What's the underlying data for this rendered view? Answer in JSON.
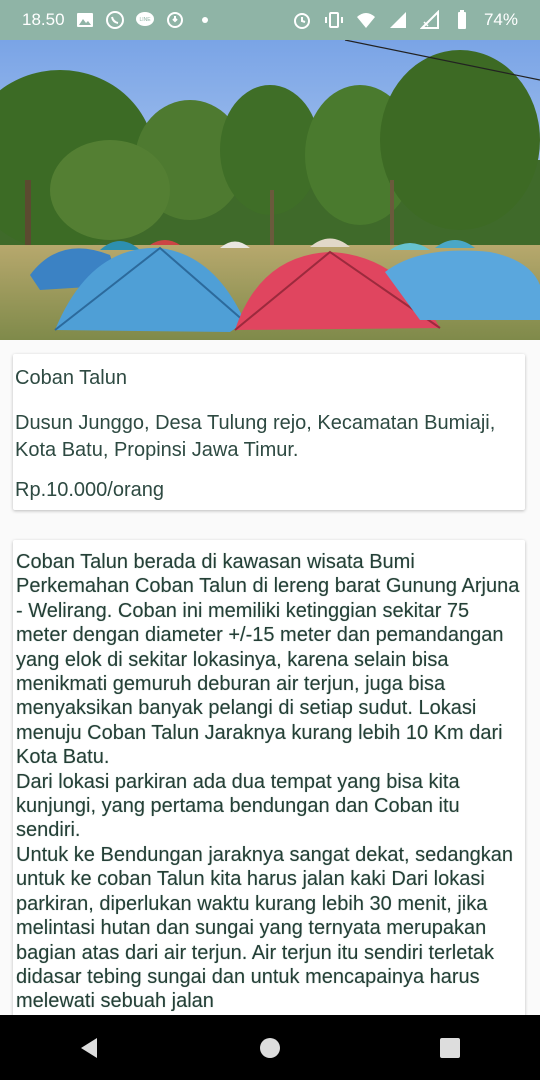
{
  "status_bar": {
    "time": "18.50",
    "battery": "74%",
    "icons_left": [
      "image-icon",
      "whatsapp-icon",
      "line-icon",
      "sync-icon",
      "dot-icon"
    ],
    "icons_right": [
      "alarm-icon",
      "vibrate-icon",
      "wifi-icon",
      "signal-icon",
      "signal-x-icon",
      "battery-icon"
    ]
  },
  "place": {
    "name": "Coban Talun",
    "address": "Dusun Junggo, Desa Tulung rejo, Kecamatan Bumiaji, Kota Batu, Propinsi Jawa Timur.",
    "price": "Rp.10.000/orang"
  },
  "description": "Coban Talun berada di kawasan wisata Bumi Perkemahan Coban Talun di lereng barat Gunung Arjuna - Welirang. Coban ini memiliki ketinggian sekitar 75 meter dengan diameter +/-15 meter dan pemandangan yang elok di sekitar lokasinya, karena selain bisa menikmati gemuruh deburan air terjun, juga bisa menyaksikan banyak pelangi di setiap sudut. Lokasi menuju Coban Talun Jaraknya kurang lebih 10 Km dari Kota Batu.\nDari lokasi parkiran ada dua tempat yang bisa kita kunjungi, yang pertama bendungan dan Coban itu sendiri.\nUntuk ke Bendungan jaraknya sangat dekat, sedangkan untuk ke coban Talun kita harus jalan kaki Dari lokasi parkiran, diperlukan waktu kurang lebih 30 menit, jika melintasi hutan dan sungai yang ternyata merupakan bagian atas dari air terjun. Air terjun itu sendiri terletak didasar tebing sungai dan untuk mencapainya harus melewati sebuah jalan",
  "nav": {
    "buttons": [
      "back-icon",
      "home-icon",
      "recents-icon"
    ]
  },
  "colors": {
    "status_bar": "#8fb4a6",
    "text": "#2e4a42",
    "nav_bar": "#000000"
  }
}
